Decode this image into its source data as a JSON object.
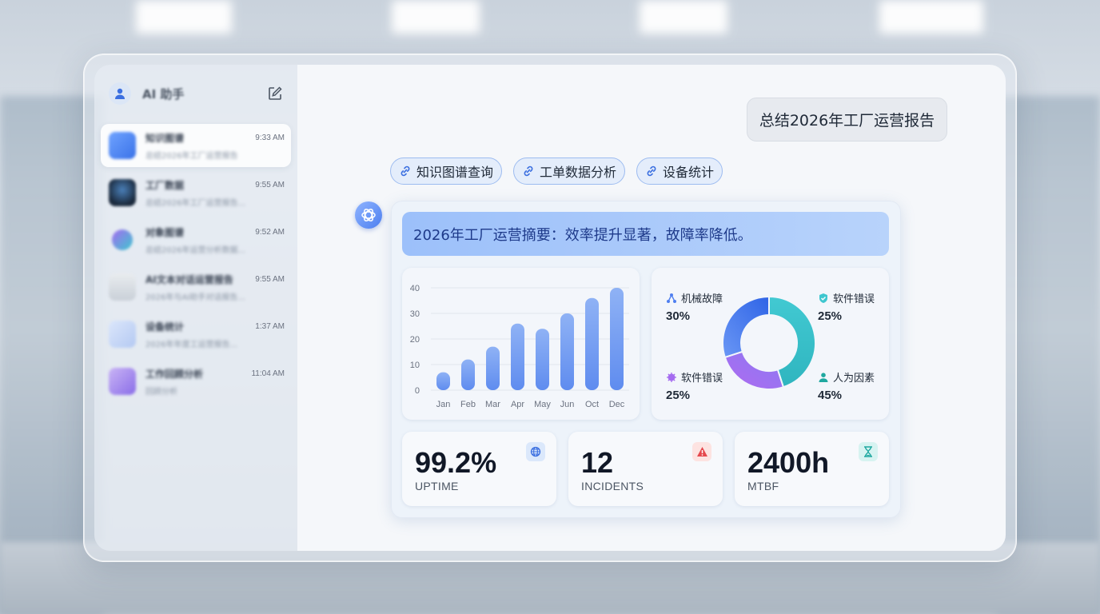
{
  "sidebar": {
    "title": "AI 助手",
    "items": [
      {
        "name": "知识图谱",
        "sub": "总结2026年工厂运营报告",
        "time": "9:33 AM"
      },
      {
        "name": "工厂数据",
        "sub": "总结2026年工厂运营报告...",
        "time": "9:55 AM"
      },
      {
        "name": "对象图谱",
        "sub": "总结2026年运营分析数据...",
        "time": "9:52 AM"
      },
      {
        "name": "AI文本对话运营报告",
        "sub": "2026年与AI助手对话报告...",
        "time": "9:55 AM"
      },
      {
        "name": "设备统计",
        "sub": "2026年年度工运营报告...",
        "time": "1:37 AM"
      },
      {
        "name": "工作回顾分析",
        "sub": "回顾分析",
        "time": "11:04 AM"
      }
    ]
  },
  "chat": {
    "user_message": "总结2026年工厂运营报告",
    "chips": [
      "知识图谱查询",
      "工单数据分析",
      "设备统计"
    ],
    "summary": "2026年工厂运营摘要：效率提升显著，故障率降低。"
  },
  "chart_data": [
    {
      "type": "bar",
      "categories": [
        "Jan",
        "Feb",
        "Mar",
        "Apr",
        "May",
        "Jun",
        "Oct",
        "Dec"
      ],
      "values": [
        7,
        12,
        17,
        26,
        24,
        30,
        36,
        40
      ],
      "yticks": [
        0,
        10,
        20,
        30,
        40
      ],
      "ylim": [
        0,
        40
      ],
      "grid": true
    },
    {
      "type": "pie",
      "labels": [
        "机械故障",
        "软件错误",
        "人为因素",
        "软件错误"
      ],
      "values": [
        30,
        25,
        45,
        25
      ],
      "percent_labels": [
        "30%",
        "25%",
        "45%",
        "25%"
      ],
      "colors": [
        "#4f7ff0",
        "#3ec6cf",
        "#3ec6cf",
        "#a56cf0"
      ]
    }
  ],
  "stats": [
    {
      "value": "99.2%",
      "label": "UPTIME",
      "icon": "globe-icon",
      "icon_bg": "#dbe8fb",
      "icon_color": "#3b6fe0"
    },
    {
      "value": "12",
      "label": "INCIDENTS",
      "icon": "warning-icon",
      "icon_bg": "#fde3e1",
      "icon_color": "#e5484d"
    },
    {
      "value": "2400h",
      "label": "MTBF",
      "icon": "hourglass-icon",
      "icon_bg": "#d7f3f1",
      "icon_color": "#1fa8a0"
    }
  ],
  "colors": {
    "accent": "#4f7ff0",
    "teal": "#3ec6cf",
    "purple": "#a56cf0"
  }
}
